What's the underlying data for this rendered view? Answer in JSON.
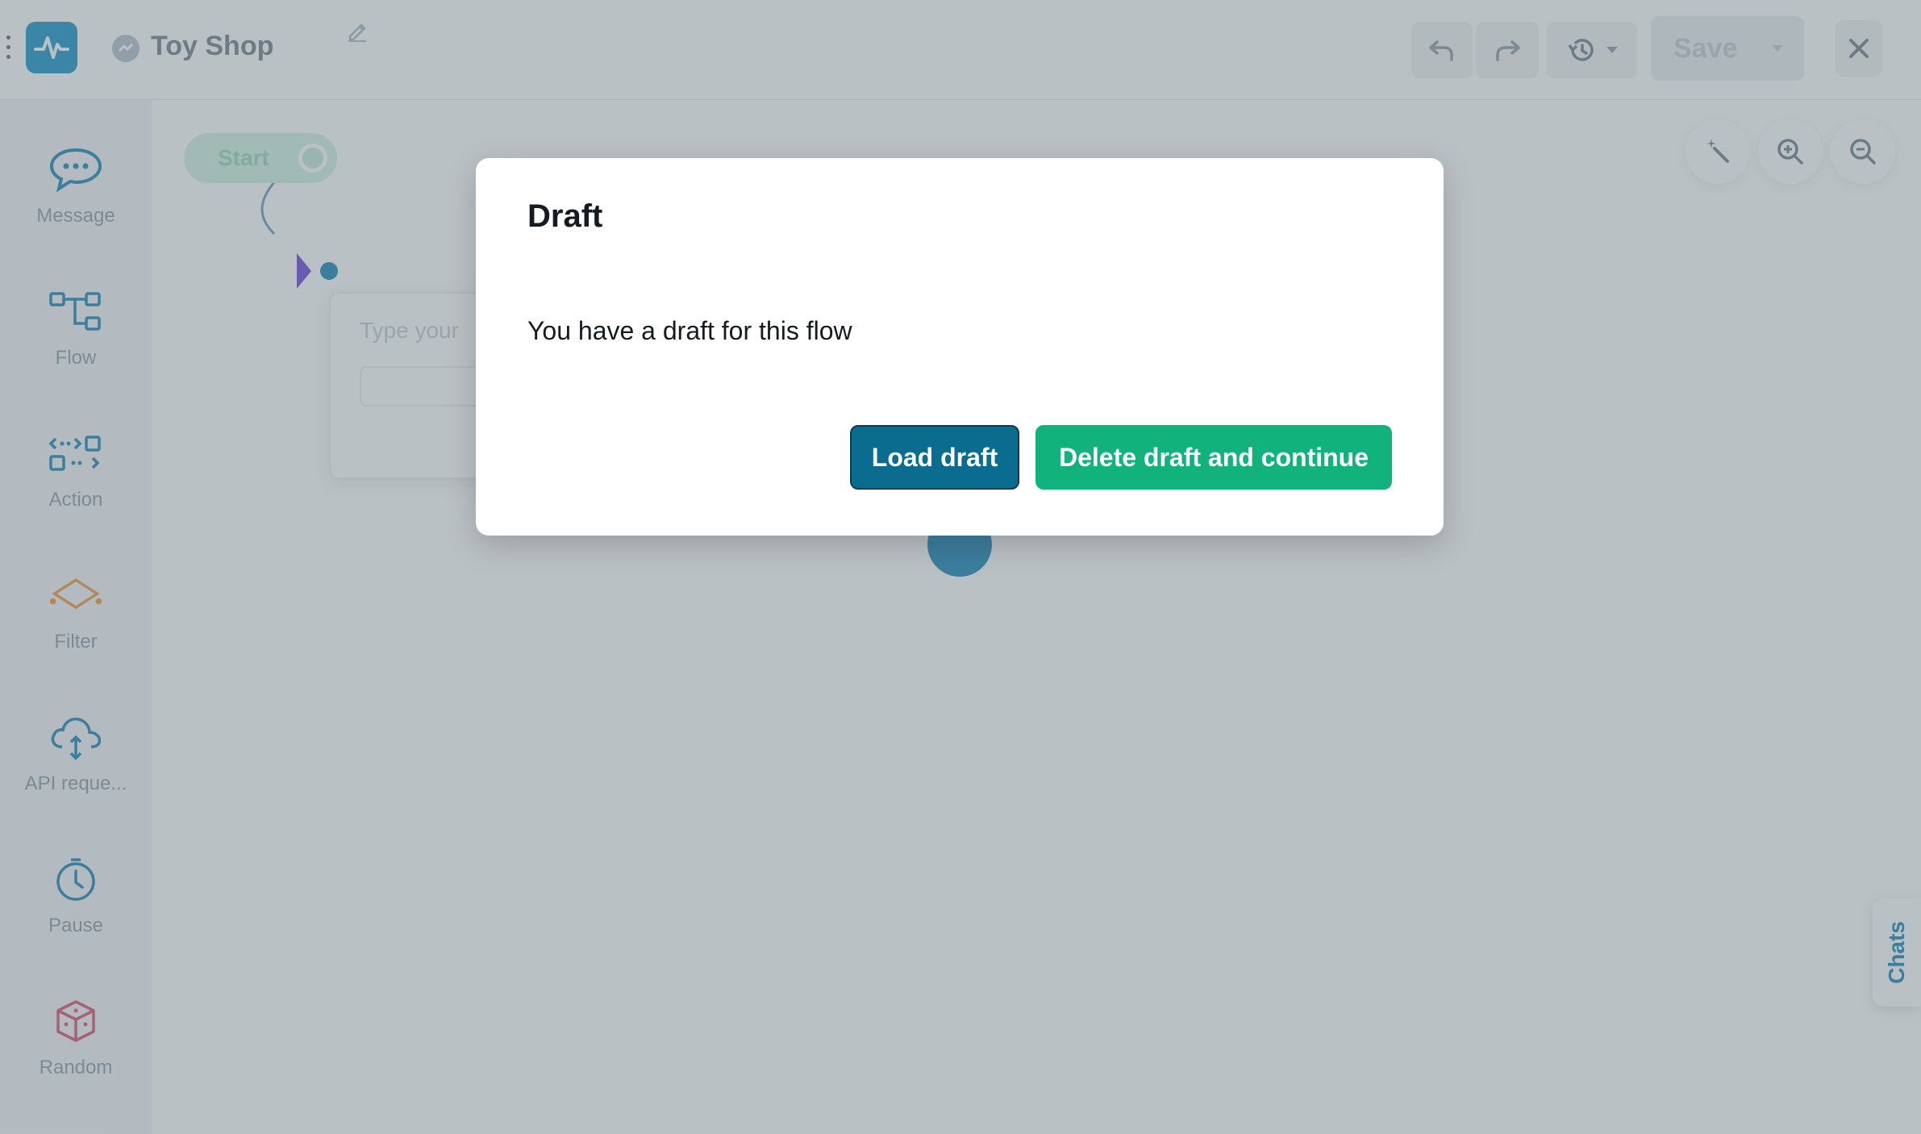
{
  "topbar": {
    "flow_title": "Toy Shop",
    "save_label": "Save"
  },
  "sidebar": {
    "items": [
      {
        "label": "Message",
        "icon": "message-icon"
      },
      {
        "label": "Flow",
        "icon": "flow-icon"
      },
      {
        "label": "Action",
        "icon": "action-icon"
      },
      {
        "label": "Filter",
        "icon": "filter-icon"
      },
      {
        "label": "API reque...",
        "icon": "api-request-icon"
      },
      {
        "label": "Pause",
        "icon": "pause-icon"
      },
      {
        "label": "Random",
        "icon": "random-icon"
      }
    ]
  },
  "canvas": {
    "start_label": "Start",
    "message_placeholder": "Type your"
  },
  "chats_tab": "Chats",
  "modal": {
    "title": "Draft",
    "message": "You have a draft for this flow",
    "load_button": "Load draft",
    "delete_button": "Delete draft and continue"
  },
  "colors": {
    "primary": "#0a6d8f",
    "success": "#12b27c",
    "overlay": "#53656b"
  }
}
